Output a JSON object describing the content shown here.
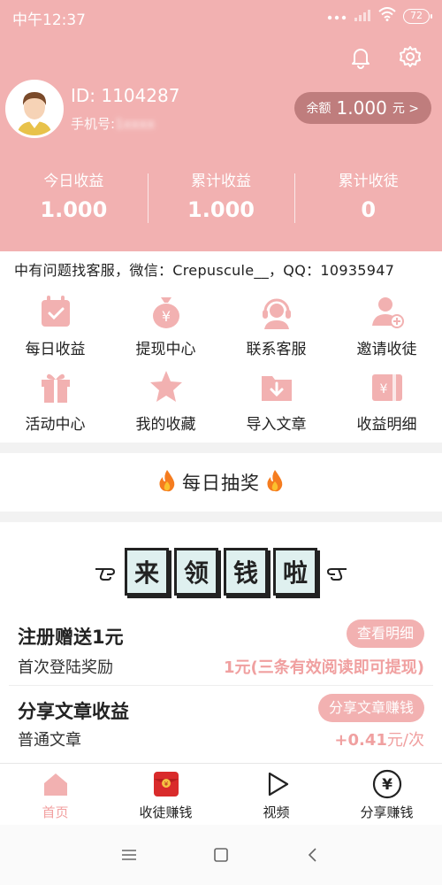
{
  "status_bar": {
    "time": "中午12:37",
    "battery": "72"
  },
  "user": {
    "id": "ID: 1104287",
    "phone_label": "手机号:",
    "phone_masked": "1xxxx"
  },
  "balance": {
    "label": "余额",
    "amount": "1.000",
    "unit": "元 >"
  },
  "stats": [
    {
      "label": "今日收益",
      "value": "1.000"
    },
    {
      "label": "累计收益",
      "value": "1.000"
    },
    {
      "label": "累计收徒",
      "value": "0"
    }
  ],
  "notice": "中有问题找客服，微信：Crepuscule__，QQ：10935947",
  "menu": [
    {
      "label": "每日收益",
      "icon": "calendar-icon"
    },
    {
      "label": "提现中心",
      "icon": "money-bag-icon"
    },
    {
      "label": "联系客服",
      "icon": "support-icon"
    },
    {
      "label": "邀请收徒",
      "icon": "add-user-icon"
    },
    {
      "label": "活动中心",
      "icon": "gift-icon"
    },
    {
      "label": "我的收藏",
      "icon": "star-icon"
    },
    {
      "label": "导入文章",
      "icon": "import-folder-icon"
    },
    {
      "label": "收益明细",
      "icon": "wallet-icon"
    }
  ],
  "lottery": {
    "title": "每日抽奖"
  },
  "banner": {
    "chars": [
      "来",
      "领",
      "钱",
      "啦"
    ]
  },
  "rewards": {
    "register": {
      "title": "注册赠送1元",
      "button": "查看明细",
      "subtitle": "首次登陆奖励",
      "value": "1元(三条有效阅读即可提现)"
    },
    "share": {
      "title": "分享文章收益",
      "button": "分享文章赚钱",
      "subtitle": "普通文章",
      "value": "+0.41",
      "value_unit": "元/次"
    }
  },
  "bottom_nav": [
    {
      "label": "首页",
      "icon": "home-icon",
      "active": true
    },
    {
      "label": "收徒赚钱",
      "icon": "red-envelope-icon",
      "active": false
    },
    {
      "label": "视频",
      "icon": "play-icon",
      "active": false
    },
    {
      "label": "分享赚钱",
      "icon": "yen-coin-icon",
      "active": false
    }
  ],
  "colors": {
    "primary": "#f2b1b1",
    "pill": "#bf7d7d",
    "accent_text": "#f0a0a0"
  }
}
